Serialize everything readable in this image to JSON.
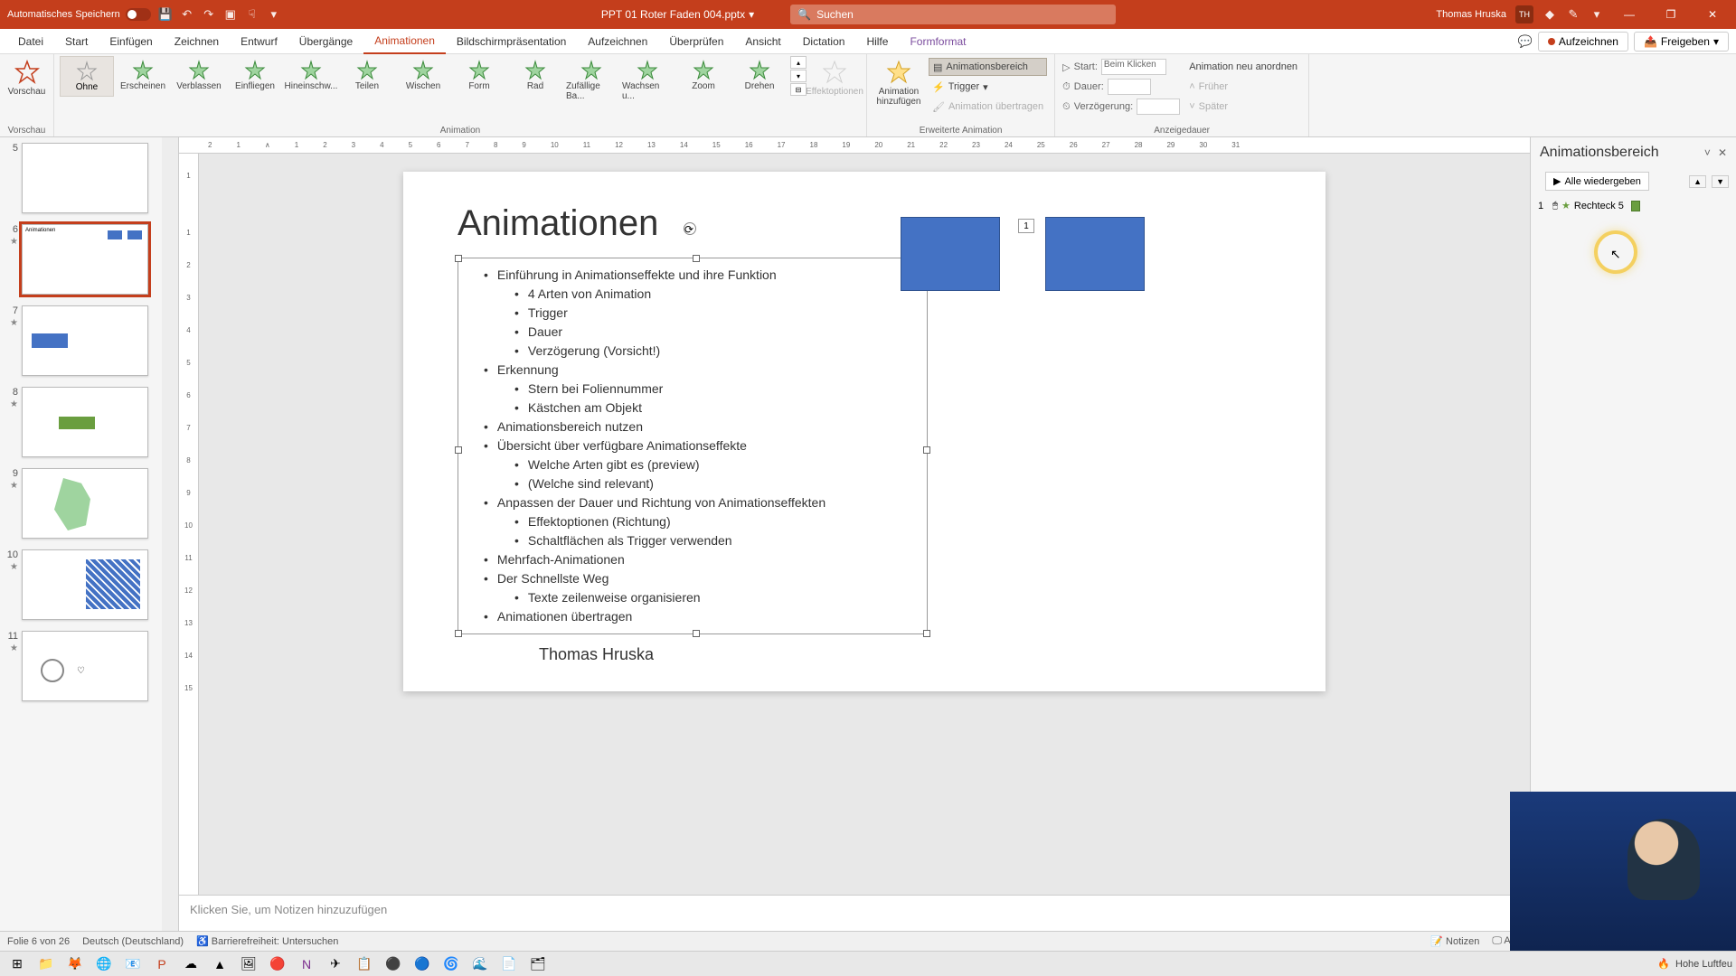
{
  "titlebar": {
    "autosave": "Automatisches Speichern",
    "filename": "PPT 01 Roter Faden 004.pptx",
    "search_placeholder": "Suchen",
    "username": "Thomas Hruska",
    "userinitials": "TH"
  },
  "tabs": {
    "items": [
      "Datei",
      "Start",
      "Einfügen",
      "Zeichnen",
      "Entwurf",
      "Übergänge",
      "Animationen",
      "Bildschirmpräsentation",
      "Aufzeichnen",
      "Überprüfen",
      "Ansicht",
      "Dictation",
      "Hilfe",
      "Formformat"
    ],
    "active": "Animationen",
    "record": "Aufzeichnen",
    "share": "Freigeben"
  },
  "ribbon": {
    "preview": "Vorschau",
    "preview_small": "Vorschau",
    "animations": [
      "Ohne",
      "Erscheinen",
      "Verblassen",
      "Einfliegen",
      "Hineinschw...",
      "Teilen",
      "Wischen",
      "Form",
      "Rad",
      "Zufällige Ba...",
      "Wachsen u...",
      "Zoom",
      "Drehen"
    ],
    "animation_group": "Animation",
    "effect_options": "Effektoptionen",
    "add_anim": "Animation hinzufügen",
    "anim_pane": "Animationsbereich",
    "trigger": "Trigger",
    "transfer": "Animation übertragen",
    "ext_anim": "Erweiterte Animation",
    "start_label": "Start:",
    "start_value": "Beim Klicken",
    "duration": "Dauer:",
    "delay": "Verzögerung:",
    "reorder": "Animation neu anordnen",
    "earlier": "Früher",
    "later": "Später",
    "timing_group": "Anzeigedauer"
  },
  "thumbs": [
    {
      "num": "5"
    },
    {
      "num": "6",
      "selected": true
    },
    {
      "num": "7"
    },
    {
      "num": "8"
    },
    {
      "num": "9"
    },
    {
      "num": "10"
    },
    {
      "num": "11"
    }
  ],
  "slide": {
    "title": "Animationen",
    "bullets": [
      {
        "l": 1,
        "t": "Einführung in Animationseffekte und ihre Funktion"
      },
      {
        "l": 2,
        "t": "4 Arten von Animation"
      },
      {
        "l": 2,
        "t": "Trigger"
      },
      {
        "l": 2,
        "t": "Dauer"
      },
      {
        "l": 2,
        "t": "Verzögerung (Vorsicht!)"
      },
      {
        "l": 1,
        "t": "Erkennung"
      },
      {
        "l": 2,
        "t": "Stern bei Foliennummer"
      },
      {
        "l": 2,
        "t": "Kästchen am Objekt"
      },
      {
        "l": 1,
        "t": "Animationsbereich nutzen"
      },
      {
        "l": 1,
        "t": ""
      },
      {
        "l": 1,
        "t": "Übersicht über verfügbare Animationseffekte"
      },
      {
        "l": 2,
        "t": "Welche Arten gibt es (preview)"
      },
      {
        "l": 2,
        "t": "(Welche sind relevant)"
      },
      {
        "l": 1,
        "t": "Anpassen der Dauer und Richtung von Animationseffekten"
      },
      {
        "l": 2,
        "t": "Effektoptionen (Richtung)"
      },
      {
        "l": 2,
        "t": "Schaltflächen als Trigger verwenden"
      },
      {
        "l": 1,
        "t": "Mehrfach-Animationen"
      },
      {
        "l": 1,
        "t": "Der Schnellste Weg"
      },
      {
        "l": 2,
        "t": "Texte zeilenweise organisieren"
      },
      {
        "l": 1,
        "t": "Animationen übertragen"
      }
    ],
    "anim_tag": "1",
    "author": "Thomas Hruska"
  },
  "notes_placeholder": "Klicken Sie, um Notizen hinzuzufügen",
  "animpane": {
    "title": "Animationsbereich",
    "play_all": "Alle wiedergeben",
    "item_num": "1",
    "item_name": "Rechteck 5"
  },
  "status": {
    "slide": "Folie 6 von 26",
    "lang": "Deutsch (Deutschland)",
    "access": "Barrierefreiheit: Untersuchen",
    "notes": "Notizen",
    "display": "Anzeigeeinstellungen"
  },
  "taskbar": {
    "weather": "Hohe Luftfeu"
  }
}
